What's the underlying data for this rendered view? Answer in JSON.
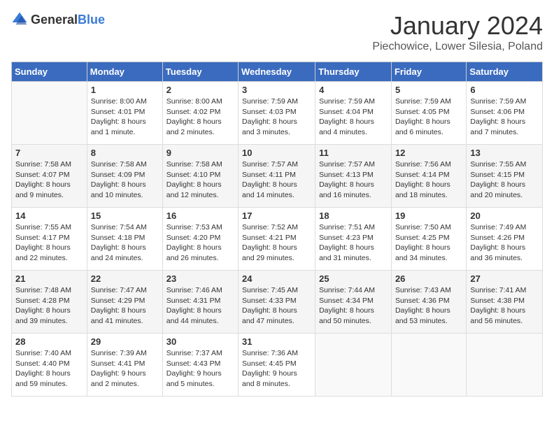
{
  "header": {
    "logo_general": "General",
    "logo_blue": "Blue",
    "title": "January 2024",
    "location": "Piechowice, Lower Silesia, Poland"
  },
  "calendar": {
    "days_of_week": [
      "Sunday",
      "Monday",
      "Tuesday",
      "Wednesday",
      "Thursday",
      "Friday",
      "Saturday"
    ],
    "weeks": [
      [
        {
          "day": "",
          "detail": ""
        },
        {
          "day": "1",
          "detail": "Sunrise: 8:00 AM\nSunset: 4:01 PM\nDaylight: 8 hours\nand 1 minute."
        },
        {
          "day": "2",
          "detail": "Sunrise: 8:00 AM\nSunset: 4:02 PM\nDaylight: 8 hours\nand 2 minutes."
        },
        {
          "day": "3",
          "detail": "Sunrise: 7:59 AM\nSunset: 4:03 PM\nDaylight: 8 hours\nand 3 minutes."
        },
        {
          "day": "4",
          "detail": "Sunrise: 7:59 AM\nSunset: 4:04 PM\nDaylight: 8 hours\nand 4 minutes."
        },
        {
          "day": "5",
          "detail": "Sunrise: 7:59 AM\nSunset: 4:05 PM\nDaylight: 8 hours\nand 6 minutes."
        },
        {
          "day": "6",
          "detail": "Sunrise: 7:59 AM\nSunset: 4:06 PM\nDaylight: 8 hours\nand 7 minutes."
        }
      ],
      [
        {
          "day": "7",
          "detail": "Sunrise: 7:58 AM\nSunset: 4:07 PM\nDaylight: 8 hours\nand 9 minutes."
        },
        {
          "day": "8",
          "detail": "Sunrise: 7:58 AM\nSunset: 4:09 PM\nDaylight: 8 hours\nand 10 minutes."
        },
        {
          "day": "9",
          "detail": "Sunrise: 7:58 AM\nSunset: 4:10 PM\nDaylight: 8 hours\nand 12 minutes."
        },
        {
          "day": "10",
          "detail": "Sunrise: 7:57 AM\nSunset: 4:11 PM\nDaylight: 8 hours\nand 14 minutes."
        },
        {
          "day": "11",
          "detail": "Sunrise: 7:57 AM\nSunset: 4:13 PM\nDaylight: 8 hours\nand 16 minutes."
        },
        {
          "day": "12",
          "detail": "Sunrise: 7:56 AM\nSunset: 4:14 PM\nDaylight: 8 hours\nand 18 minutes."
        },
        {
          "day": "13",
          "detail": "Sunrise: 7:55 AM\nSunset: 4:15 PM\nDaylight: 8 hours\nand 20 minutes."
        }
      ],
      [
        {
          "day": "14",
          "detail": "Sunrise: 7:55 AM\nSunset: 4:17 PM\nDaylight: 8 hours\nand 22 minutes."
        },
        {
          "day": "15",
          "detail": "Sunrise: 7:54 AM\nSunset: 4:18 PM\nDaylight: 8 hours\nand 24 minutes."
        },
        {
          "day": "16",
          "detail": "Sunrise: 7:53 AM\nSunset: 4:20 PM\nDaylight: 8 hours\nand 26 minutes."
        },
        {
          "day": "17",
          "detail": "Sunrise: 7:52 AM\nSunset: 4:21 PM\nDaylight: 8 hours\nand 29 minutes."
        },
        {
          "day": "18",
          "detail": "Sunrise: 7:51 AM\nSunset: 4:23 PM\nDaylight: 8 hours\nand 31 minutes."
        },
        {
          "day": "19",
          "detail": "Sunrise: 7:50 AM\nSunset: 4:25 PM\nDaylight: 8 hours\nand 34 minutes."
        },
        {
          "day": "20",
          "detail": "Sunrise: 7:49 AM\nSunset: 4:26 PM\nDaylight: 8 hours\nand 36 minutes."
        }
      ],
      [
        {
          "day": "21",
          "detail": "Sunrise: 7:48 AM\nSunset: 4:28 PM\nDaylight: 8 hours\nand 39 minutes."
        },
        {
          "day": "22",
          "detail": "Sunrise: 7:47 AM\nSunset: 4:29 PM\nDaylight: 8 hours\nand 41 minutes."
        },
        {
          "day": "23",
          "detail": "Sunrise: 7:46 AM\nSunset: 4:31 PM\nDaylight: 8 hours\nand 44 minutes."
        },
        {
          "day": "24",
          "detail": "Sunrise: 7:45 AM\nSunset: 4:33 PM\nDaylight: 8 hours\nand 47 minutes."
        },
        {
          "day": "25",
          "detail": "Sunrise: 7:44 AM\nSunset: 4:34 PM\nDaylight: 8 hours\nand 50 minutes."
        },
        {
          "day": "26",
          "detail": "Sunrise: 7:43 AM\nSunset: 4:36 PM\nDaylight: 8 hours\nand 53 minutes."
        },
        {
          "day": "27",
          "detail": "Sunrise: 7:41 AM\nSunset: 4:38 PM\nDaylight: 8 hours\nand 56 minutes."
        }
      ],
      [
        {
          "day": "28",
          "detail": "Sunrise: 7:40 AM\nSunset: 4:40 PM\nDaylight: 8 hours\nand 59 minutes."
        },
        {
          "day": "29",
          "detail": "Sunrise: 7:39 AM\nSunset: 4:41 PM\nDaylight: 9 hours\nand 2 minutes."
        },
        {
          "day": "30",
          "detail": "Sunrise: 7:37 AM\nSunset: 4:43 PM\nDaylight: 9 hours\nand 5 minutes."
        },
        {
          "day": "31",
          "detail": "Sunrise: 7:36 AM\nSunset: 4:45 PM\nDaylight: 9 hours\nand 8 minutes."
        },
        {
          "day": "",
          "detail": ""
        },
        {
          "day": "",
          "detail": ""
        },
        {
          "day": "",
          "detail": ""
        }
      ]
    ]
  }
}
